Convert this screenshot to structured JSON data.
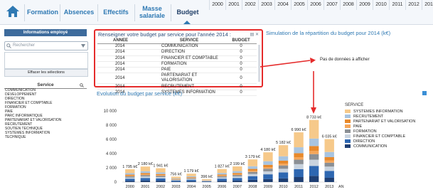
{
  "nav": {
    "tabs": [
      "Formation",
      "Absences",
      "Effectifs",
      "Masse salariale",
      "Budget"
    ],
    "active_tab": "Budget",
    "years": [
      "2000",
      "2001",
      "2002",
      "2003",
      "2004",
      "2005",
      "2006",
      "2007",
      "2008",
      "2009",
      "2010",
      "2011",
      "2012",
      "2013",
      "2014"
    ]
  },
  "left_panel": {
    "header": "Informations employé",
    "search_placeholder": "Rechercher",
    "clear_label": "Effacer les sélections",
    "service_header": "Service",
    "services": [
      "COMMUNICATION",
      "DEVELOPPEMENT",
      "DIRECTION",
      "FINANCIER ET COMPTABLE",
      "FORMATION",
      "PAIE",
      "PARC INFORMATIQUE",
      "PARTENARIAT ET VALORISATION",
      "RECRUTEMENT",
      "SOUTIEN TECHNIQUE",
      "SYSTEMES INFORMATION",
      "TECHNIQUE"
    ]
  },
  "budget_table": {
    "title": "Renseigner votre budget par service pour l'année 2014 :",
    "columns": [
      "ANNEE",
      "SERVICE",
      "BUDGET"
    ],
    "rows": [
      [
        "2014",
        "COMMUNICATION",
        "0"
      ],
      [
        "2014",
        "DIRECTION",
        "0"
      ],
      [
        "2014",
        "FINANCIER ET COMPTABLE",
        "0"
      ],
      [
        "2014",
        "FORMATION",
        "0"
      ],
      [
        "2014",
        "PAIE",
        "0"
      ],
      [
        "2014",
        "PARTENARIAT ET VALORISATION",
        "0"
      ],
      [
        "2014",
        "RECRUTEMENT",
        "0"
      ],
      [
        "2014",
        "SYSTEMES INFORMATION",
        "0"
      ]
    ]
  },
  "simulation": {
    "title": "Simulation de la répartition du budget pour 2014 (k€)",
    "empty_message": "Pas de données à afficher"
  },
  "evolution": {
    "title": "Evolution du budget par service (k€)"
  },
  "colors": {
    "nav_blue": "#2f79b3",
    "highlight_red": "#e52b2b",
    "header_navy": "#3d6b9c"
  },
  "chart_data": {
    "type": "bar",
    "stacked": true,
    "categories": [
      "2000",
      "2001",
      "2002",
      "2003",
      "2004",
      "2005",
      "2006",
      "2007",
      "2008",
      "2009",
      "2010",
      "2011",
      "2012",
      "2013"
    ],
    "totals": [
      1795,
      2180,
      1941,
      756,
      1179,
      396,
      1827,
      2199,
      3179,
      4180,
      5182,
      6990,
      8733,
      6035
    ],
    "total_labels": [
      "1 795 k€",
      "2 180 k€",
      "1 941 k€",
      "756 k€",
      "1 179 k€",
      "396 k€",
      "1 827 k€",
      "2 199 k€",
      "3 179 k€",
      "4 180 k€",
      "5 182 k€",
      "6 990 k€",
      "8 733 k€",
      "6 035 k€"
    ],
    "series_shares": [
      {
        "name": "SYSTEMES INFORMATION",
        "color": "#f6c98a",
        "share": 0.3
      },
      {
        "name": "RECRUTEMENT",
        "color": "#a8c4e0",
        "share": 0.12
      },
      {
        "name": "PARTENARIAT ET VALORISATION",
        "color": "#e8892b",
        "share": 0.08
      },
      {
        "name": "PAIE",
        "color": "#f5a65a",
        "share": 0.05
      },
      {
        "name": "FORMATION",
        "color": "#8b8f94",
        "share": 0.09
      },
      {
        "name": "FINANCIER ET COMPTABLE",
        "color": "#c9d3de",
        "share": 0.1
      },
      {
        "name": "DIRECTION",
        "color": "#2e67b1",
        "share": 0.16
      },
      {
        "name": "COMMUNICATION",
        "color": "#1f3f73",
        "share": 0.1
      }
    ],
    "legend_title": "SERVICE",
    "xlabel": "ANNEE",
    "ylabel": "",
    "yticks": [
      "0",
      "2 000",
      "4 000",
      "6 000",
      "8 000",
      "10 000"
    ],
    "ylim": [
      0,
      10000
    ],
    "grid": false,
    "legend_position": "right"
  }
}
